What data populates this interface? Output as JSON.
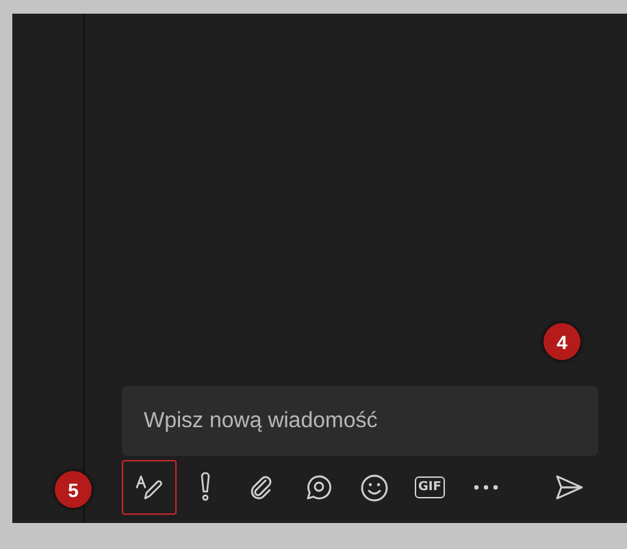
{
  "compose": {
    "placeholder": "Wpisz nową wiadomość"
  },
  "toolbar": [
    {
      "kind": "format",
      "selected": true
    },
    {
      "kind": "important",
      "selected": false
    },
    {
      "kind": "attach",
      "selected": false
    },
    {
      "kind": "loop",
      "selected": false
    },
    {
      "kind": "emoji",
      "selected": false
    },
    {
      "kind": "gif",
      "label": "GIF",
      "selected": false
    },
    {
      "kind": "more",
      "selected": false
    }
  ],
  "send": {
    "kind": "send"
  },
  "callouts": [
    {
      "label": "4",
      "kind": "compose"
    },
    {
      "label": "5",
      "kind": "toolbar"
    }
  ]
}
